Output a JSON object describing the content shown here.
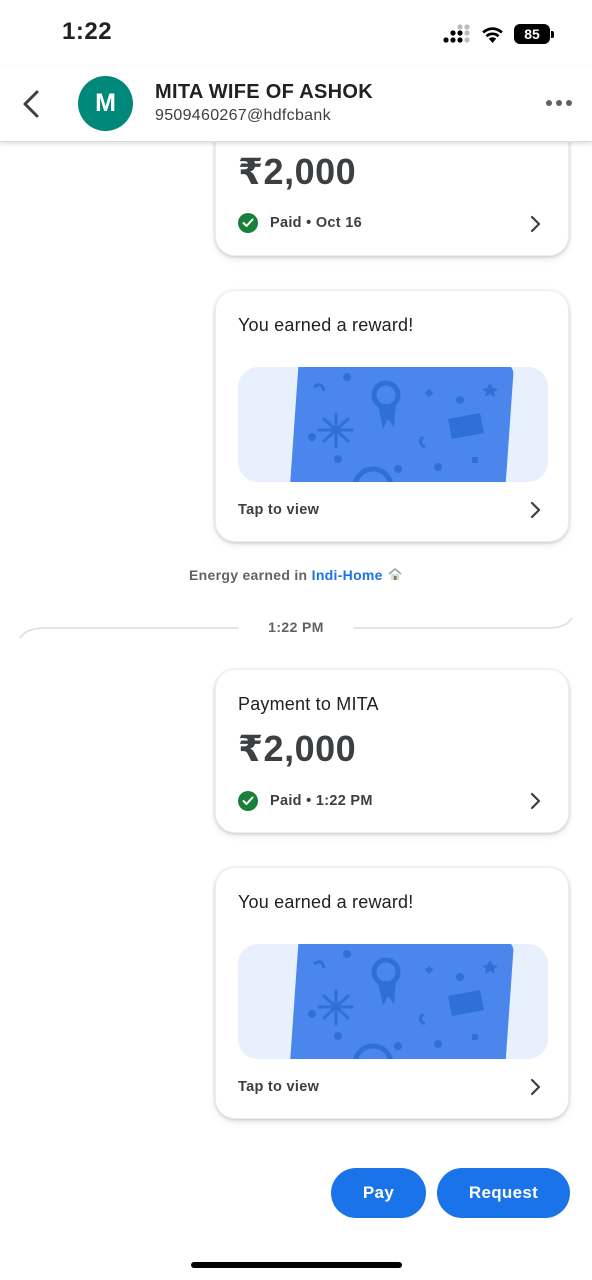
{
  "status_bar": {
    "time": "1:22",
    "battery": "85"
  },
  "header": {
    "avatar_letter": "M",
    "contact_name": "MITA WIFE OF ASHOK",
    "contact_upi": "9509460267@hdfcbank"
  },
  "messages": [
    {
      "amount": "₹2,000",
      "status": "Paid • Oct 16"
    },
    {
      "reward_title": "You earned a reward!",
      "tap_label": "Tap to view"
    }
  ],
  "energy": {
    "prefix": "Energy earned in",
    "link": "Indi-Home"
  },
  "time_divider": "1:22 PM",
  "latest": [
    {
      "title": "Payment to MITA",
      "amount": "₹2,000",
      "status": "Paid • 1:22 PM"
    },
    {
      "reward_title": "You earned a reward!",
      "tap_label": "Tap to view"
    }
  ],
  "actions": {
    "pay": "Pay",
    "request": "Request"
  },
  "colors": {
    "accent": "#1a73e8",
    "avatar": "#00897b",
    "paid": "#188038",
    "card_art": "#4a86ec"
  }
}
